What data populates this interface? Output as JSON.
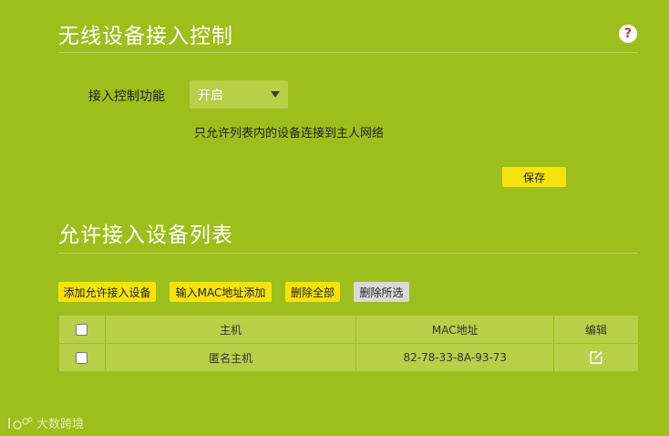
{
  "access_control": {
    "title": "无线设备接入控制",
    "help_icon": "help-icon",
    "function_label": "接入控制功能",
    "function_value": "开启",
    "hint": "只允许列表内的设备连接到主人网络",
    "save_label": "保存"
  },
  "allow_list": {
    "title": "允许接入设备列表",
    "buttons": {
      "add_allowed": "添加允许接入设备",
      "add_by_mac": "输入MAC地址添加",
      "delete_all": "删除全部",
      "delete_selected": "删除所选"
    },
    "columns": [
      "主机",
      "MAC地址",
      "编辑"
    ],
    "rows": [
      {
        "host": "匿名主机",
        "mac": "82-78-33-8A-93-73"
      }
    ]
  },
  "watermark": {
    "text": "大数跨境"
  },
  "colors": {
    "background": "#9dbf1b",
    "panel": "#b6d048",
    "accent_button": "#f6e20c",
    "disabled_button": "#d9d9d9"
  }
}
